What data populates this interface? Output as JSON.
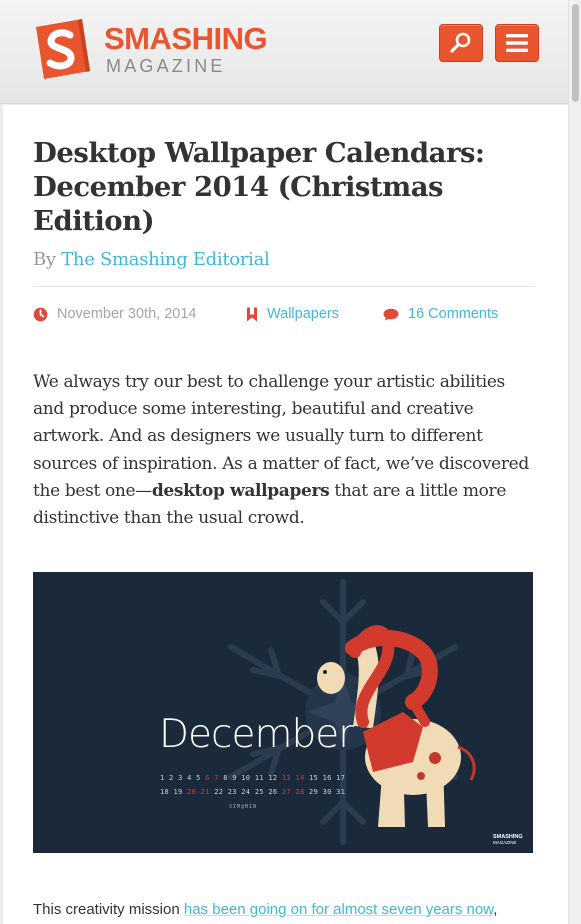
{
  "header": {
    "brand_top": "SMASHING",
    "brand_bottom": "MAGAZINE",
    "search_icon": "search-icon",
    "menu_icon": "hamburger-menu-icon"
  },
  "article": {
    "title": "Desktop Wallpaper Calendars: December 2014 (Christmas Edition)",
    "by_label": "By",
    "author": "The Smashing Editorial",
    "date": "November 30th, 2014",
    "category": "Wallpapers",
    "comments": "16 Comments",
    "intro_before": "We always try our best to challenge your artistic abilities and produce some interesting, beautiful and creative artwork. And as designers we usually turn to different sources of inspiration. As a matter of fact, we’ve discovered the best one—",
    "intro_bold": "desktop wallpapers",
    "intro_after": " that are a little more distinctive than the usual crowd.",
    "footer_before": "This creativity mission ",
    "footer_link": "has been going on for almost seven years now",
    "footer_after": ","
  },
  "wallpaper": {
    "month": "December",
    "days_row1": [
      "1",
      "2",
      "3",
      "4",
      "5",
      "6",
      "7",
      "8",
      "9",
      "10",
      "11",
      "12",
      "13",
      "14",
      "15",
      "16",
      "17"
    ],
    "days_row2": [
      "18",
      "19",
      "20",
      "21",
      "22",
      "23",
      "24",
      "25",
      "26",
      "27",
      "28",
      "29",
      "30",
      "31"
    ],
    "signature": "XIM@MIN",
    "watermark_top": "SMASHING",
    "watermark_bottom": "MAGAZINE"
  },
  "colors": {
    "brand": "#e9552f",
    "link": "#41b7d8",
    "text": "#333333",
    "muted": "#999999",
    "wallpaper_bg": "#1b2a3a"
  }
}
